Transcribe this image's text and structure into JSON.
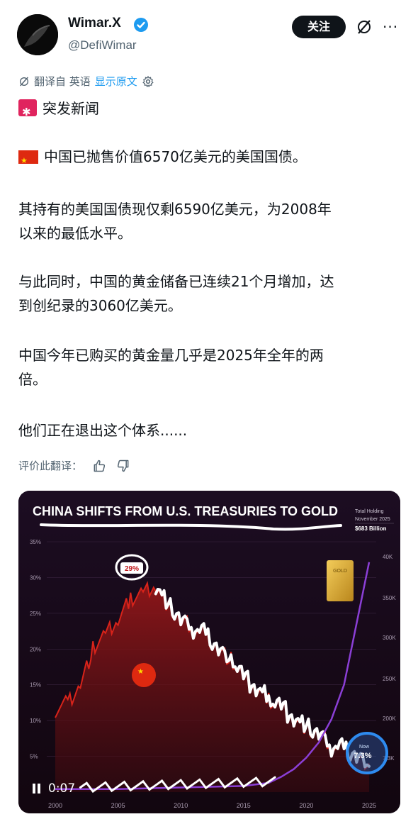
{
  "author": {
    "name": "Wimar.X",
    "handle": "@DefiWimar",
    "follow_label": "关注",
    "more_label": "···"
  },
  "translation": {
    "translated_from": "翻译自 英语",
    "show_original": "显示原文"
  },
  "post": {
    "line1": "突发新闻",
    "line2": "中国已抛售价值6570亿美元的美国国债。",
    "para3_l1": "其持有的美国国债现仅剩6590亿美元，为2008年",
    "para3_l2": "以来的最低水平。",
    "para4_l1": "与此同时，中国的黄金储备已连续21个月增加，达",
    "para4_l2": "到创纪录的3060亿美元。",
    "para5_l1": "中国今年已购买的黄金量几乎是2025年全年的两",
    "para5_l2": "倍。",
    "para6": "他们正在退出这个体系......"
  },
  "rate_translation_label": "评价此翻译：",
  "video": {
    "time": "0:07"
  },
  "chart_data": {
    "type": "line",
    "title": "CHINA SHIFTS FROM U.S. TREASURIES TO GOLD",
    "legend_box": {
      "label1": "Total Holding",
      "label2": "November 2025",
      "value": "$683 Billion"
    },
    "x_ticks": [
      "2000",
      "2005",
      "2010",
      "2015",
      "2020",
      "2025"
    ],
    "y_left_ticks": [
      "35%",
      "30%",
      "25%",
      "20%",
      "15%",
      "10%",
      "5%"
    ],
    "y_right_ticks": [
      "40K",
      "350K",
      "300K",
      "250K",
      "200K",
      "7.3K"
    ],
    "gold_bar_label": "GOLD",
    "series": [
      {
        "color": "#d8231a",
        "x": [
          2000,
          2001,
          2002,
          2003,
          2004,
          2005,
          2006,
          2007,
          2008,
          2009,
          2010,
          2011,
          2012,
          2013,
          2014,
          2015,
          2016,
          2017,
          2018,
          2019,
          2020,
          2021,
          2022,
          2023,
          2024,
          2025
        ],
        "values": [
          11.5,
          12.5,
          15,
          20,
          22,
          24,
          27,
          28,
          29,
          26,
          24,
          23,
          22,
          20,
          18.5,
          16,
          14.5,
          13,
          12,
          10.5,
          9,
          8,
          6.5,
          6,
          5,
          4
        ]
      },
      {
        "color": "#8b3fd6",
        "x": [
          2000,
          2005,
          2010,
          2015,
          2017,
          2018,
          2019,
          2020,
          2021,
          2022,
          2023,
          2024,
          2025
        ],
        "values": [
          4,
          4,
          6,
          8,
          12,
          20,
          30,
          45,
          65,
          95,
          140,
          220,
          300
        ]
      }
    ],
    "annotations": {
      "peak_label": "29%",
      "end_label": "7.3%",
      "end_label_top": "Now"
    },
    "ylim": [
      0,
      35
    ]
  },
  "colors": {
    "follow_bg": "#0f1419",
    "accent_blue": "#1d9bf0",
    "verified": "#1d9bf0",
    "chart_bg": "#1a0a1c",
    "chart_red": "#d8231a",
    "chart_purple": "#8b3fd6",
    "gold": "#e2b03a"
  }
}
